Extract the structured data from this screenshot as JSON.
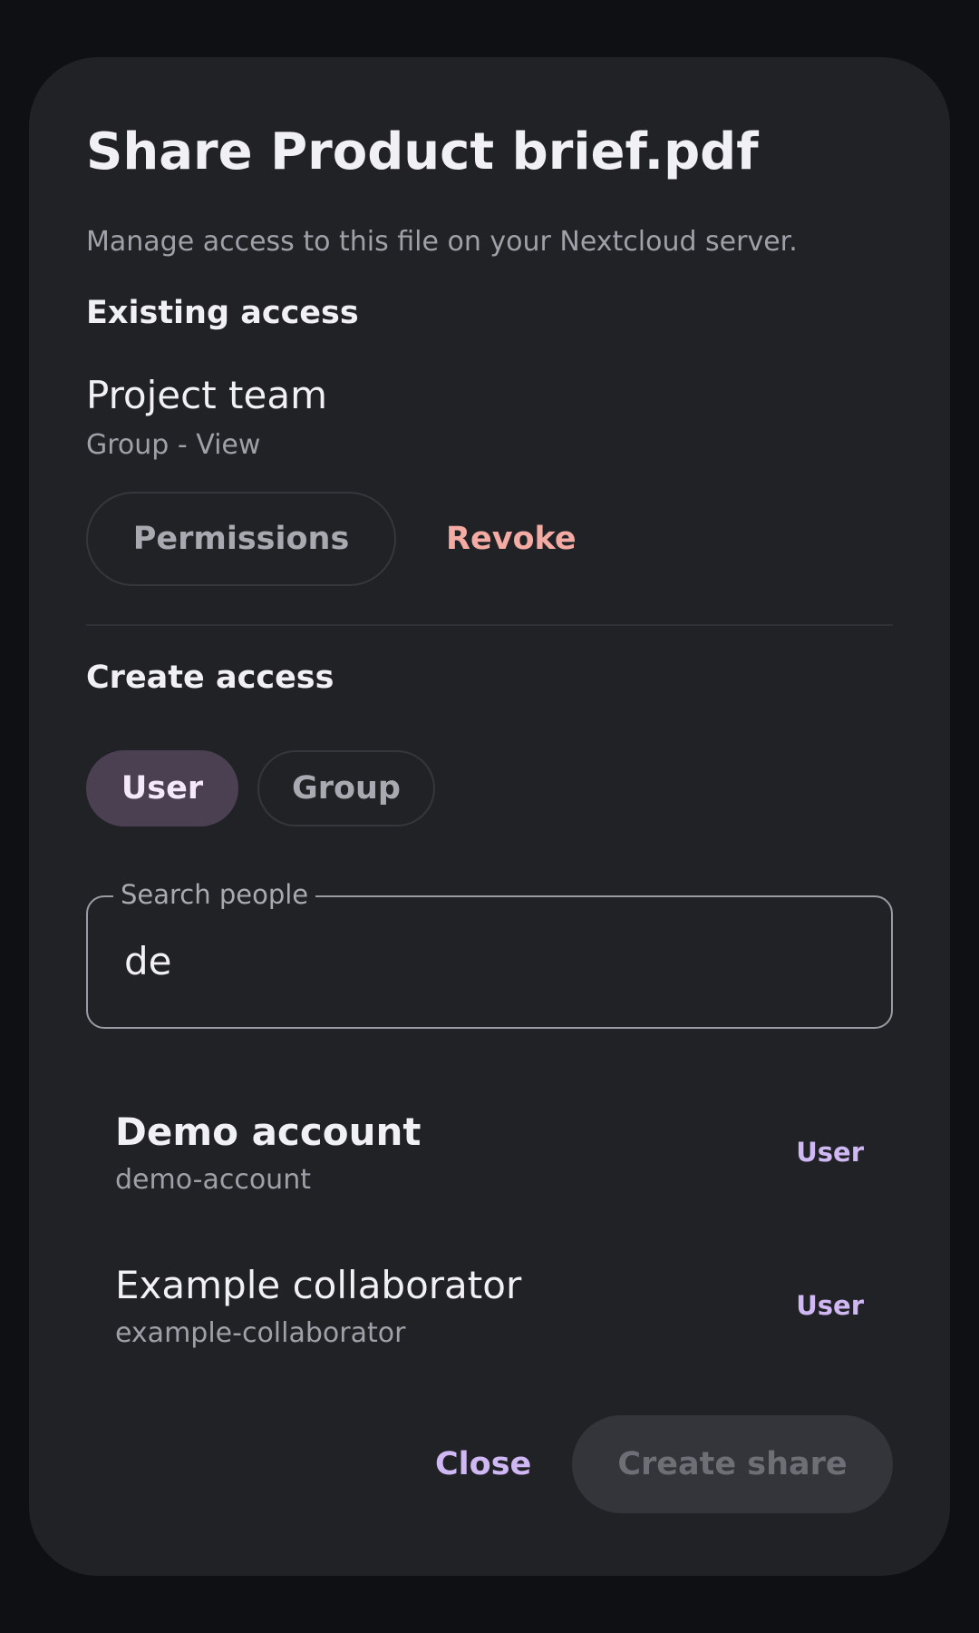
{
  "dialog": {
    "title": "Share Product brief.pdf",
    "subtitle": "Manage access to this file on your Nextcloud server."
  },
  "existing_access": {
    "heading": "Existing access",
    "entries": [
      {
        "name": "Project team",
        "meta": "Group - View",
        "permissions_label": "Permissions",
        "revoke_label": "Revoke"
      }
    ]
  },
  "create_access": {
    "heading": "Create access",
    "type_options": [
      {
        "label": "User",
        "selected": true
      },
      {
        "label": "Group",
        "selected": false
      }
    ],
    "search": {
      "label": "Search people",
      "value": "de"
    },
    "results": [
      {
        "name": "Demo account",
        "id": "demo-account",
        "type": "User"
      },
      {
        "name": "Example collaborator",
        "id": "example-collaborator",
        "type": "User"
      }
    ]
  },
  "footer": {
    "close_label": "Close",
    "create_label": "Create share"
  },
  "colors": {
    "background": "#0f1013",
    "surface": "#212226",
    "accent": "#d0b8f5",
    "danger": "#f4aba3",
    "selected_chip": "#4a4051"
  }
}
